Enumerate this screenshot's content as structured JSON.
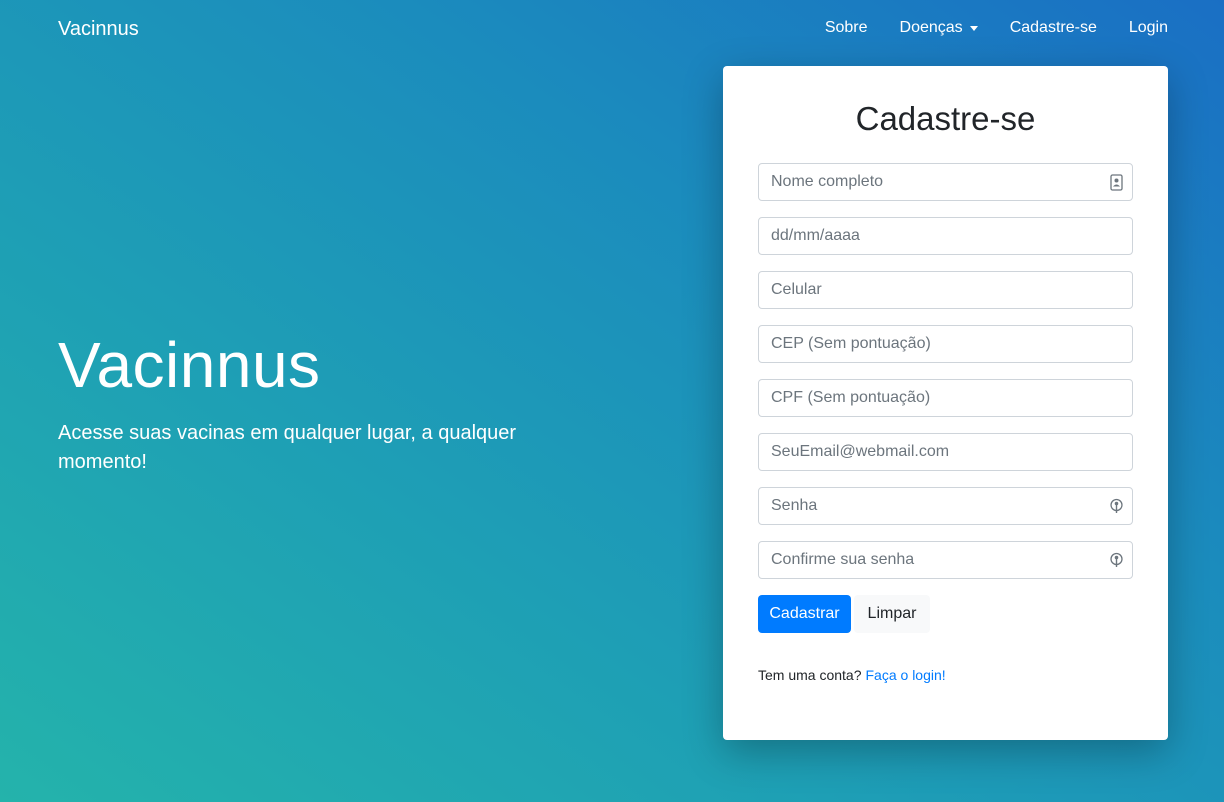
{
  "navbar": {
    "brand": "Vacinnus",
    "links": [
      {
        "label": "Sobre"
      },
      {
        "label": "Doenças"
      },
      {
        "label": "Cadastre-se"
      },
      {
        "label": "Login"
      }
    ]
  },
  "hero": {
    "title": "Vacinnus",
    "subtitle": "Acesse suas vacinas em qualquer lugar, a qualquer momento!"
  },
  "form": {
    "title": "Cadastre-se",
    "fields": {
      "name": {
        "placeholder": "Nome completo",
        "icon": "contact-card-icon"
      },
      "birthdate": {
        "placeholder": "dd/mm/aaaa"
      },
      "phone": {
        "placeholder": "Celular"
      },
      "cep": {
        "placeholder": "CEP (Sem pontuação)"
      },
      "cpf": {
        "placeholder": "CPF (Sem pontuação)"
      },
      "email": {
        "placeholder": "SeuEmail@webmail.com"
      },
      "password": {
        "placeholder": "Senha",
        "icon": "password-key-icon"
      },
      "confirm_password": {
        "placeholder": "Confirme sua senha",
        "icon": "password-key-icon"
      }
    },
    "submit_label": "Cadastrar",
    "clear_label": "Limpar",
    "login_prompt": "Tem uma conta?",
    "login_link": "Faça o login!"
  },
  "colors": {
    "primary": "#007bff",
    "gradient_start": "#24b3ab",
    "gradient_end": "#1a6fc4"
  }
}
